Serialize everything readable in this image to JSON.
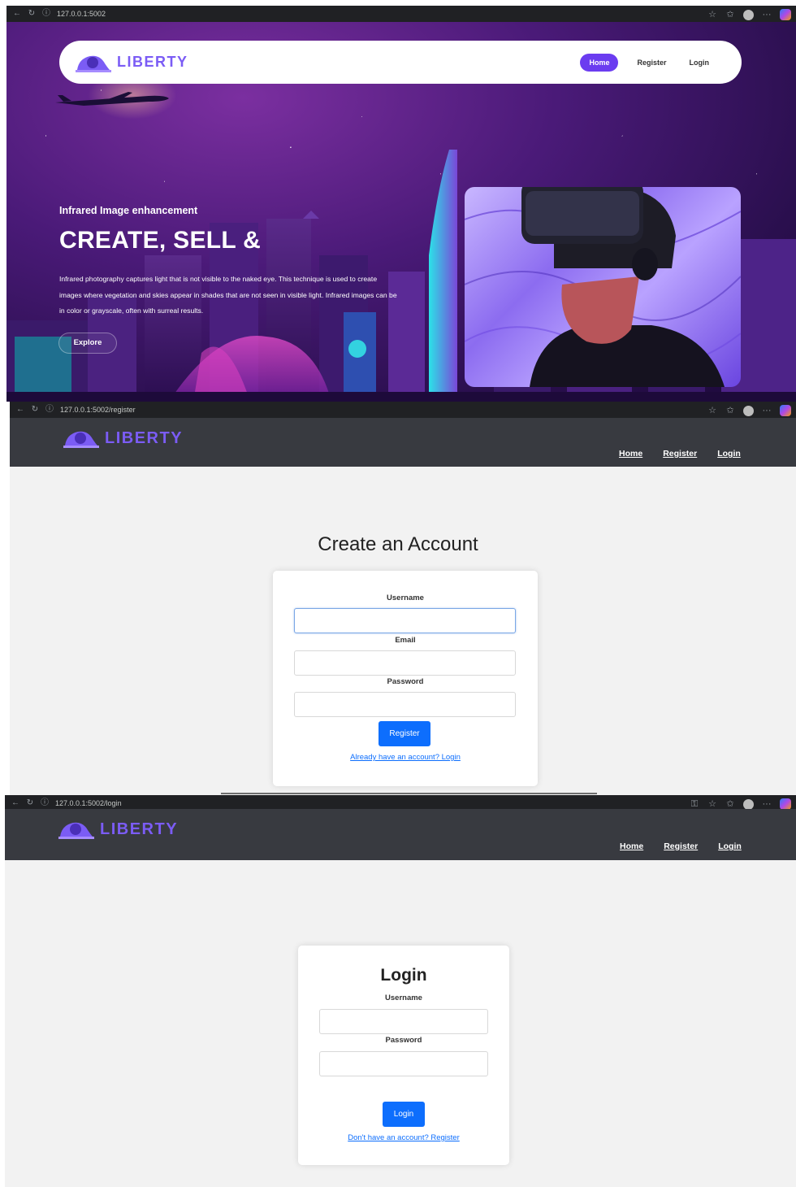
{
  "brand": {
    "name": "LIBERTY",
    "color": "#7b5cf5"
  },
  "landing": {
    "url": "127.0.0.1:5002",
    "nav": {
      "home": "Home",
      "register": "Register",
      "login": "Login"
    },
    "kicker": "Infrared Image enhancement",
    "title": "CREATE, SELL &",
    "description": "Infrared photography captures light that is not visible to the naked eye. This technique is used to create images where vegetation and skies appear in shades that are not seen in visible light. Infrared images can be in color or grayscale, often with surreal results.",
    "explore": "Explore"
  },
  "register_page": {
    "url": "127.0.0.1:5002/register",
    "nav": {
      "home": "Home",
      "register": "Register",
      "login": "Login"
    },
    "heading": "Create an Account",
    "username_label": "Username",
    "username_value": "",
    "email_label": "Email",
    "email_value": "",
    "password_label": "Password",
    "password_value": "",
    "submit": "Register",
    "alt_link": "Already have an account? Login"
  },
  "login_page": {
    "url": "127.0.0.1:5002/login",
    "nav": {
      "home": "Home",
      "register": "Register",
      "login": "Login"
    },
    "heading": "Login",
    "username_label": "Username",
    "username_value": "",
    "password_label": "Password",
    "password_value": "",
    "submit": "Login",
    "alt_link": "Don't have an account? Register"
  },
  "colors": {
    "primary_button": "#0d6efd",
    "appbar": "#383a40",
    "hero_pill": "#6b3cf0"
  }
}
